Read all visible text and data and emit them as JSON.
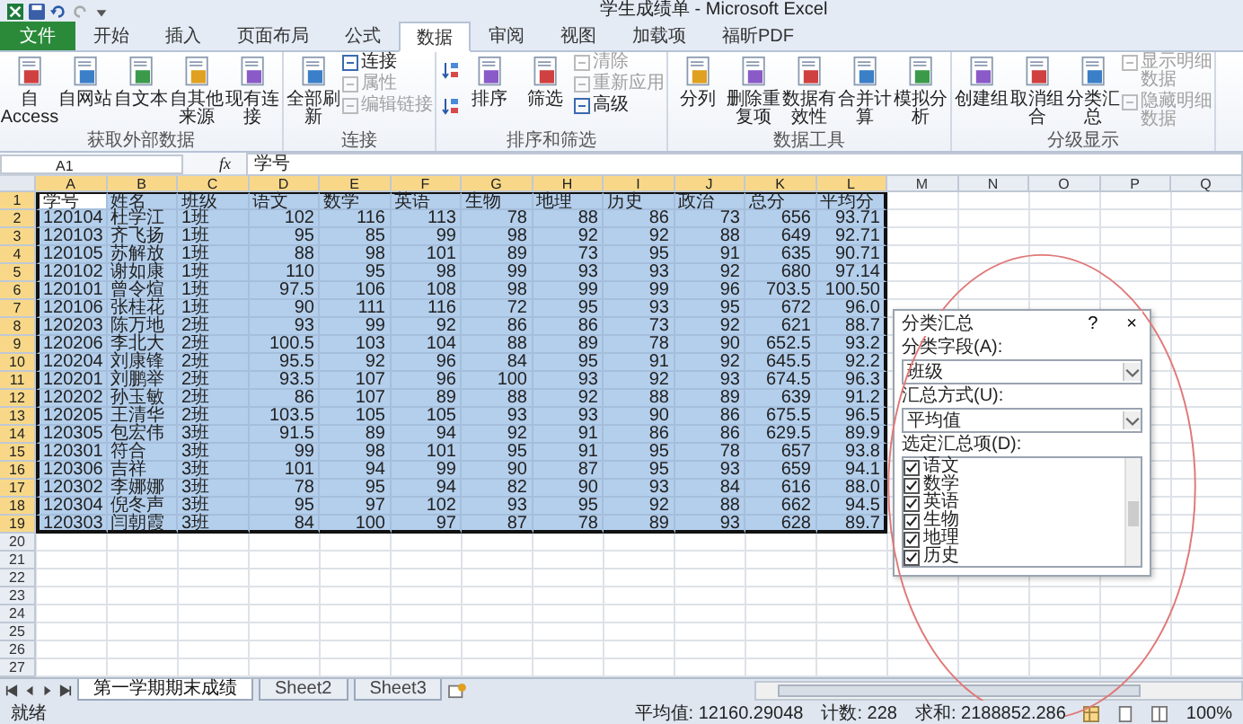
{
  "window": {
    "title": "学生成绩单 - Microsoft Excel"
  },
  "ribbon_tabs": [
    {
      "label": "文件",
      "kind": "file"
    },
    {
      "label": "开始",
      "kind": "tab",
      "selected": false
    },
    {
      "label": "插入",
      "kind": "tab",
      "selected": false
    },
    {
      "label": "页面布局",
      "kind": "tab",
      "selected": false
    },
    {
      "label": "公式",
      "kind": "tab",
      "selected": false
    },
    {
      "label": "数据",
      "kind": "tab",
      "selected": true
    },
    {
      "label": "审阅",
      "kind": "tab",
      "selected": false
    },
    {
      "label": "视图",
      "kind": "tab",
      "selected": false
    },
    {
      "label": "加载项",
      "kind": "tab",
      "selected": false
    },
    {
      "label": "福昕PDF",
      "kind": "tab",
      "selected": false
    }
  ],
  "ribbon_groups": [
    {
      "label": "获取外部数据",
      "buttons": [
        {
          "kind": "large",
          "label": "自 Access",
          "disabled": false
        },
        {
          "kind": "large",
          "label": "自网站",
          "disabled": false
        },
        {
          "kind": "large",
          "label": "自文本",
          "disabled": false
        },
        {
          "kind": "large",
          "label": "自其他来源",
          "disabled": false
        },
        {
          "kind": "large",
          "label": "现有连接",
          "disabled": false
        }
      ]
    },
    {
      "label": "连接",
      "buttons": [
        {
          "kind": "large",
          "label": "全部刷新",
          "disabled": false
        },
        {
          "kind": "small",
          "label": "连接",
          "disabled": false
        },
        {
          "kind": "small",
          "label": "属性",
          "disabled": true
        },
        {
          "kind": "small",
          "label": "编辑链接",
          "disabled": true
        }
      ]
    },
    {
      "label": "排序和筛选",
      "buttons": [
        {
          "kind": "sort"
        },
        {
          "kind": "sort"
        },
        {
          "kind": "large",
          "label": "排序",
          "disabled": false
        },
        {
          "kind": "large",
          "label": "筛选",
          "disabled": false
        },
        {
          "kind": "small",
          "label": "清除",
          "disabled": true
        },
        {
          "kind": "small",
          "label": "重新应用",
          "disabled": true
        },
        {
          "kind": "small",
          "label": "高级",
          "disabled": false
        }
      ]
    },
    {
      "label": "数据工具",
      "buttons": [
        {
          "kind": "large",
          "label": "分列",
          "disabled": false
        },
        {
          "kind": "large",
          "label": "删除重复项",
          "disabled": false
        },
        {
          "kind": "large",
          "label": "数据有效性",
          "disabled": false
        },
        {
          "kind": "large",
          "label": "合并计算",
          "disabled": false
        },
        {
          "kind": "large",
          "label": "模拟分析",
          "disabled": false
        }
      ]
    },
    {
      "label": "分级显示",
      "buttons": [
        {
          "kind": "large",
          "label": "创建组",
          "disabled": false
        },
        {
          "kind": "large",
          "label": "取消组合",
          "disabled": false
        },
        {
          "kind": "large",
          "label": "分类汇总",
          "disabled": false
        },
        {
          "kind": "small",
          "label": "显示明细数据",
          "disabled": true
        },
        {
          "kind": "small",
          "label": "隐藏明细数据",
          "disabled": true
        }
      ]
    }
  ],
  "formula_bar": {
    "name_box": "A1",
    "function_label": "fx",
    "value": "学号"
  },
  "sheet": {
    "columns": [
      {
        "label": "A",
        "selected": true
      },
      {
        "label": "B",
        "selected": true
      },
      {
        "label": "C",
        "selected": true
      },
      {
        "label": "D",
        "selected": true
      },
      {
        "label": "E",
        "selected": true
      },
      {
        "label": "F",
        "selected": true
      },
      {
        "label": "G",
        "selected": true
      },
      {
        "label": "H",
        "selected": true
      },
      {
        "label": "I",
        "selected": true
      },
      {
        "label": "J",
        "selected": true
      },
      {
        "label": "K",
        "selected": true
      },
      {
        "label": "L",
        "selected": true
      },
      {
        "label": "M",
        "selected": false
      },
      {
        "label": "N",
        "selected": false
      },
      {
        "label": "O",
        "selected": false
      },
      {
        "label": "P",
        "selected": false
      },
      {
        "label": "Q",
        "selected": false
      }
    ],
    "row_headers": [
      {
        "label": "1",
        "selected": true
      },
      {
        "label": "2",
        "selected": true
      },
      {
        "label": "3",
        "selected": true
      },
      {
        "label": "4",
        "selected": true
      },
      {
        "label": "5",
        "selected": true
      },
      {
        "label": "6",
        "selected": true
      },
      {
        "label": "7",
        "selected": true
      },
      {
        "label": "8",
        "selected": true
      },
      {
        "label": "9",
        "selected": true
      },
      {
        "label": "10",
        "selected": true
      },
      {
        "label": "11",
        "selected": true
      },
      {
        "label": "12",
        "selected": true
      },
      {
        "label": "13",
        "selected": true
      },
      {
        "label": "14",
        "selected": true
      },
      {
        "label": "15",
        "selected": true
      },
      {
        "label": "16",
        "selected": true
      },
      {
        "label": "17",
        "selected": true
      },
      {
        "label": "18",
        "selected": true
      },
      {
        "label": "19",
        "selected": true
      },
      {
        "label": "20",
        "selected": false
      },
      {
        "label": "21",
        "selected": false
      },
      {
        "label": "22",
        "selected": false
      },
      {
        "label": "23",
        "selected": false
      },
      {
        "label": "24",
        "selected": false
      },
      {
        "label": "25",
        "selected": false
      },
      {
        "label": "26",
        "selected": false
      },
      {
        "label": "27",
        "selected": false
      }
    ],
    "rows": [
      {
        "selected": true,
        "active": true,
        "cells": [
          "学号",
          "姓名",
          "班级",
          "语文",
          "数学",
          "英语",
          "生物",
          "地理",
          "历史",
          "政治",
          "总分",
          "平均分"
        ]
      },
      {
        "selected": true,
        "active": false,
        "cells": [
          "120104",
          "杜学江",
          "1班",
          "102",
          "116",
          "113",
          "78",
          "88",
          "86",
          "73",
          "656",
          "93.71"
        ]
      },
      {
        "selected": true,
        "active": false,
        "cells": [
          "120103",
          "齐飞扬",
          "1班",
          "95",
          "85",
          "99",
          "98",
          "92",
          "92",
          "88",
          "649",
          "92.71"
        ]
      },
      {
        "selected": true,
        "active": false,
        "cells": [
          "120105",
          "苏解放",
          "1班",
          "88",
          "98",
          "101",
          "89",
          "73",
          "95",
          "91",
          "635",
          "90.71"
        ]
      },
      {
        "selected": true,
        "active": false,
        "cells": [
          "120102",
          "谢如康",
          "1班",
          "110",
          "95",
          "98",
          "99",
          "93",
          "93",
          "92",
          "680",
          "97.14"
        ]
      },
      {
        "selected": true,
        "active": false,
        "cells": [
          "120101",
          "曾令煊",
          "1班",
          "97.5",
          "106",
          "108",
          "98",
          "99",
          "99",
          "96",
          "703.5",
          "100.50"
        ]
      },
      {
        "selected": true,
        "active": false,
        "cells": [
          "120106",
          "张桂花",
          "1班",
          "90",
          "111",
          "116",
          "72",
          "95",
          "93",
          "95",
          "672",
          "96.0"
        ]
      },
      {
        "selected": true,
        "active": false,
        "cells": [
          "120203",
          "陈万地",
          "2班",
          "93",
          "99",
          "92",
          "86",
          "86",
          "73",
          "92",
          "621",
          "88.7"
        ]
      },
      {
        "selected": true,
        "active": false,
        "cells": [
          "120206",
          "李北大",
          "2班",
          "100.5",
          "103",
          "104",
          "88",
          "89",
          "78",
          "90",
          "652.5",
          "93.2"
        ]
      },
      {
        "selected": true,
        "active": false,
        "cells": [
          "120204",
          "刘康锋",
          "2班",
          "95.5",
          "92",
          "96",
          "84",
          "95",
          "91",
          "92",
          "645.5",
          "92.2"
        ]
      },
      {
        "selected": true,
        "active": false,
        "cells": [
          "120201",
          "刘鹏举",
          "2班",
          "93.5",
          "107",
          "96",
          "100",
          "93",
          "92",
          "93",
          "674.5",
          "96.3"
        ]
      },
      {
        "selected": true,
        "active": false,
        "cells": [
          "120202",
          "孙玉敏",
          "2班",
          "86",
          "107",
          "89",
          "88",
          "92",
          "88",
          "89",
          "639",
          "91.2"
        ]
      },
      {
        "selected": true,
        "active": false,
        "cells": [
          "120205",
          "王清华",
          "2班",
          "103.5",
          "105",
          "105",
          "93",
          "93",
          "90",
          "86",
          "675.5",
          "96.5"
        ]
      },
      {
        "selected": true,
        "active": false,
        "cells": [
          "120305",
          "包宏伟",
          "3班",
          "91.5",
          "89",
          "94",
          "92",
          "91",
          "86",
          "86",
          "629.5",
          "89.9"
        ]
      },
      {
        "selected": true,
        "active": false,
        "cells": [
          "120301",
          "符合",
          "3班",
          "99",
          "98",
          "101",
          "95",
          "91",
          "95",
          "78",
          "657",
          "93.8"
        ]
      },
      {
        "selected": true,
        "active": false,
        "cells": [
          "120306",
          "吉祥",
          "3班",
          "101",
          "94",
          "99",
          "90",
          "87",
          "95",
          "93",
          "659",
          "94.1"
        ]
      },
      {
        "selected": true,
        "active": false,
        "cells": [
          "120302",
          "李娜娜",
          "3班",
          "78",
          "95",
          "94",
          "82",
          "90",
          "93",
          "84",
          "616",
          "88.0"
        ]
      },
      {
        "selected": true,
        "active": false,
        "cells": [
          "120304",
          "倪冬声",
          "3班",
          "95",
          "97",
          "102",
          "93",
          "95",
          "92",
          "88",
          "662",
          "94.5"
        ]
      },
      {
        "selected": true,
        "active": false,
        "cells": [
          "120303",
          "闫朝霞",
          "3班",
          "84",
          "100",
          "97",
          "87",
          "78",
          "89",
          "93",
          "628",
          "89.7"
        ]
      }
    ]
  },
  "dialog": {
    "title": "分类汇总",
    "help": "?",
    "close": "×",
    "group_by_label": "分类字段(A):",
    "group_by_value": "班级",
    "function_label": "汇总方式(U):",
    "function_value": "平均值",
    "items_label": "选定汇总项(D):",
    "items": [
      {
        "label": "语文",
        "checked": true
      },
      {
        "label": "数学",
        "checked": true
      },
      {
        "label": "英语",
        "checked": true
      },
      {
        "label": "生物",
        "checked": true
      },
      {
        "label": "地理",
        "checked": true
      },
      {
        "label": "历史",
        "checked": true
      }
    ]
  },
  "sheet_tabs": [
    {
      "label": "第一学期期末成绩",
      "selected": true
    },
    {
      "label": "Sheet2",
      "selected": false
    },
    {
      "label": "Sheet3",
      "selected": false
    }
  ],
  "status_bar": {
    "mode": "就绪",
    "average": "平均值: 12160.29048",
    "count": "计数: 228",
    "sum": "求和: 2188852.286",
    "zoom": "100%"
  }
}
